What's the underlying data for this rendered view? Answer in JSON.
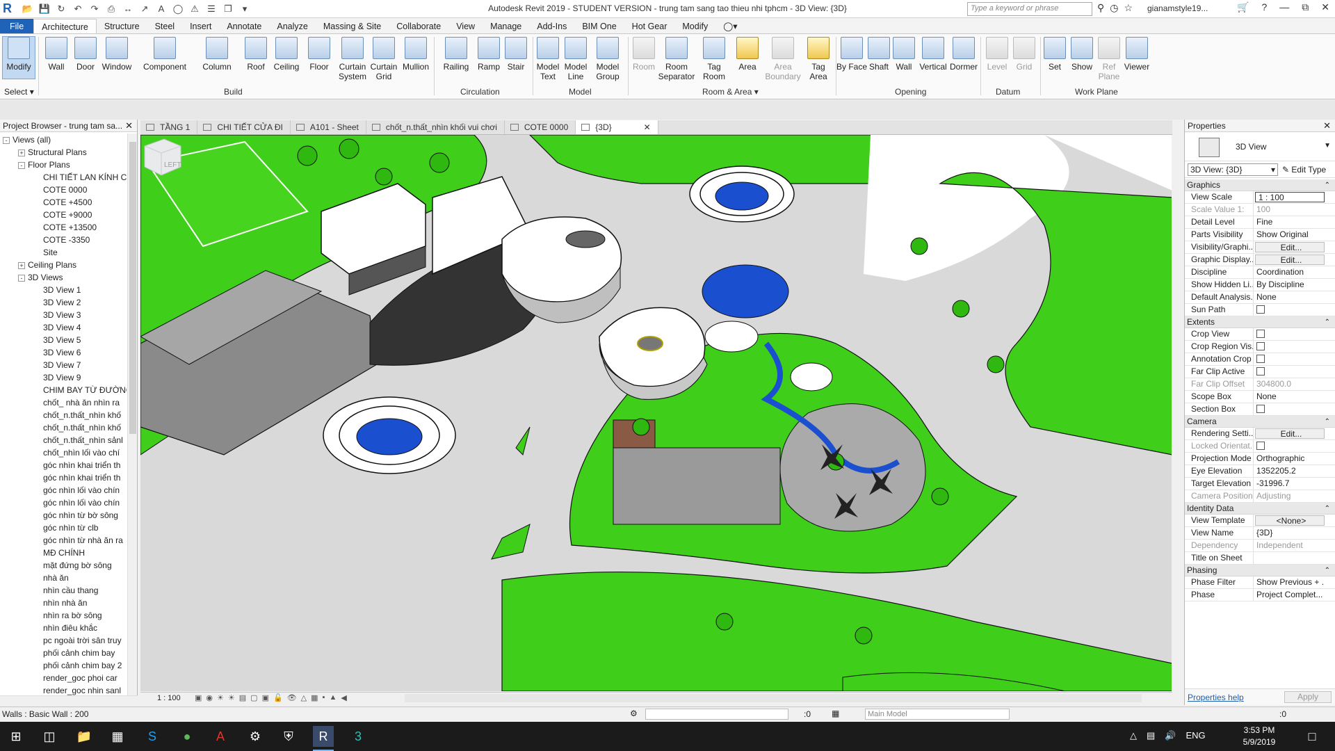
{
  "app": {
    "title": "Autodesk Revit 2019 - STUDENT VERSION - trung tam sang tao thieu nhi tphcm - 3D View: {3D}",
    "logo": "R",
    "search_placeholder": "Type a keyword or phrase",
    "user": "gianamstyle19...",
    "accent": "#1f63b8"
  },
  "ribbon_tabs": [
    "File",
    "Architecture",
    "Structure",
    "Steel",
    "Insert",
    "Annotate",
    "Analyze",
    "Massing & Site",
    "Collaborate",
    "View",
    "Manage",
    "Add-Ins",
    "BIM One",
    "Hot Gear",
    "Modify"
  ],
  "ribbon": {
    "select_label": "Select",
    "modify": "Modify",
    "build": [
      "Wall",
      "Door",
      "Window",
      "Component",
      "Column",
      "Roof",
      "Ceiling",
      "Floor",
      "Curtain System",
      "Curtain Grid",
      "Mullion"
    ],
    "circulation": [
      "Railing",
      "Ramp",
      "Stair"
    ],
    "model": [
      "Model Text",
      "Model Line",
      "Model Group"
    ],
    "room_area": [
      "Room",
      "Room Separator",
      "Tag Room",
      "Area",
      "Area Boundary",
      "Tag Area"
    ],
    "opening": [
      "By Face",
      "Shaft",
      "Wall",
      "Vertical",
      "Dormer"
    ],
    "datum": [
      "Level",
      "Grid"
    ],
    "work_plane": [
      "Set",
      "Show",
      "Ref Plane",
      "Viewer"
    ],
    "panels": {
      "build": "Build",
      "circulation": "Circulation",
      "model": "Model",
      "room_area": "Room & Area",
      "opening": "Opening",
      "datum": "Datum",
      "work_plane": "Work Plane"
    }
  },
  "project_browser": {
    "title": "Project Browser - trung tam sa...",
    "rows": [
      {
        "t": "Views (all)",
        "lvl": 0,
        "tg": "-"
      },
      {
        "t": "Structural Plans",
        "lvl": 1,
        "tg": "+"
      },
      {
        "t": "Floor Plans",
        "lvl": 1,
        "tg": "-"
      },
      {
        "t": "CHI TIẾT LAN KÍNH CẦU",
        "lvl": 2
      },
      {
        "t": "COTE 0000",
        "lvl": 2
      },
      {
        "t": "COTE +4500",
        "lvl": 2
      },
      {
        "t": "COTE +9000",
        "lvl": 2
      },
      {
        "t": "COTE +13500",
        "lvl": 2
      },
      {
        "t": "COTE -3350",
        "lvl": 2
      },
      {
        "t": "Site",
        "lvl": 2
      },
      {
        "t": "Ceiling Plans",
        "lvl": 1,
        "tg": "+"
      },
      {
        "t": "3D Views",
        "lvl": 1,
        "tg": "-"
      },
      {
        "t": "3D View 1",
        "lvl": 2
      },
      {
        "t": "3D View 2",
        "lvl": 2
      },
      {
        "t": "3D View 3",
        "lvl": 2
      },
      {
        "t": "3D View 4",
        "lvl": 2
      },
      {
        "t": "3D View 5",
        "lvl": 2
      },
      {
        "t": "3D View 6",
        "lvl": 2
      },
      {
        "t": "3D View 7",
        "lvl": 2
      },
      {
        "t": "3D View 9",
        "lvl": 2
      },
      {
        "t": "CHIM BAY TỪ ĐƯỜNG",
        "lvl": 2
      },
      {
        "t": "chốt_ nhà ăn nhìn ra",
        "lvl": 2
      },
      {
        "t": "chốt_n.thất_nhìn khố",
        "lvl": 2
      },
      {
        "t": "chốt_n.thất_nhìn khố",
        "lvl": 2
      },
      {
        "t": "chốt_n.thất_nhìn sảnl",
        "lvl": 2
      },
      {
        "t": "chốt_nhìn lối vào chí",
        "lvl": 2
      },
      {
        "t": "góc nhìn khai triển th",
        "lvl": 2
      },
      {
        "t": "góc nhìn khai triển th",
        "lvl": 2
      },
      {
        "t": "góc nhìn lối vào chín",
        "lvl": 2
      },
      {
        "t": "góc nhìn lối vào chín",
        "lvl": 2
      },
      {
        "t": "góc nhìn từ bờ sông",
        "lvl": 2
      },
      {
        "t": "góc nhìn từ clb",
        "lvl": 2
      },
      {
        "t": "góc nhìn từ nhà ăn ra",
        "lvl": 2
      },
      {
        "t": "MĐ CHÍNH",
        "lvl": 2
      },
      {
        "t": "mặt đứng bờ sông",
        "lvl": 2
      },
      {
        "t": "nhà ăn",
        "lvl": 2
      },
      {
        "t": "nhìn cầu thang",
        "lvl": 2
      },
      {
        "t": "nhìn nhà ăn",
        "lvl": 2
      },
      {
        "t": "nhìn ra bờ sông",
        "lvl": 2
      },
      {
        "t": "nhìn điêu khắc",
        "lvl": 2
      },
      {
        "t": "pc ngoài trời sân truy",
        "lvl": 2
      },
      {
        "t": "phối cảnh chim bay",
        "lvl": 2
      },
      {
        "t": "phối cảnh chim bay 2",
        "lvl": 2
      },
      {
        "t": "render_goc  phoi car",
        "lvl": 2
      },
      {
        "t": "render_goc nhin sanl",
        "lvl": 2
      }
    ]
  },
  "view_tabs": [
    "TẦNG 1",
    "CHI TIẾT CỬA ĐI",
    "A101 - Sheet",
    "chốt_n.thất_nhìn khối vui chơi",
    "COTE 0000",
    "{3D}"
  ],
  "viewcube_label": "LEFT",
  "view_control": {
    "scale": "1 : 100"
  },
  "properties": {
    "title": "Properties",
    "type_name": "3D View",
    "selector": "3D View: {3D}",
    "edit_type": "Edit Type",
    "help": "Properties help",
    "apply": "Apply",
    "sections": [
      {
        "name": "Graphics",
        "rows": [
          {
            "k": "View Scale",
            "v": "1 : 100",
            "style": "boxed"
          },
          {
            "k": "Scale Value    1:",
            "v": "100",
            "dim": true
          },
          {
            "k": "Detail Level",
            "v": "Fine"
          },
          {
            "k": "Parts Visibility",
            "v": "Show Original"
          },
          {
            "k": "Visibility/Graphi...",
            "v": "Edit...",
            "style": "btn"
          },
          {
            "k": "Graphic Display...",
            "v": "Edit...",
            "style": "btn"
          },
          {
            "k": "Discipline",
            "v": "Coordination"
          },
          {
            "k": "Show Hidden Li...",
            "v": "By Discipline"
          },
          {
            "k": "Default Analysis...",
            "v": "None"
          },
          {
            "k": "Sun Path",
            "v": "",
            "cb": true
          }
        ]
      },
      {
        "name": "Extents",
        "rows": [
          {
            "k": "Crop View",
            "v": "",
            "cb": true
          },
          {
            "k": "Crop Region Vis...",
            "v": "",
            "cb": true
          },
          {
            "k": "Annotation Crop",
            "v": "",
            "cb": true
          },
          {
            "k": "Far Clip Active",
            "v": "",
            "cb": true
          },
          {
            "k": "Far Clip Offset",
            "v": "304800.0",
            "dim": true
          },
          {
            "k": "Scope Box",
            "v": "None"
          },
          {
            "k": "Section Box",
            "v": "",
            "cb": true
          }
        ]
      },
      {
        "name": "Camera",
        "rows": [
          {
            "k": "Rendering Setti...",
            "v": "Edit...",
            "style": "btn"
          },
          {
            "k": "Locked Orientat...",
            "v": "",
            "dim": true,
            "cb": true
          },
          {
            "k": "Projection Mode",
            "v": "Orthographic"
          },
          {
            "k": "Eye Elevation",
            "v": "1352205.2"
          },
          {
            "k": "Target Elevation",
            "v": "-31996.7"
          },
          {
            "k": "Camera Position",
            "v": "Adjusting",
            "dim": true
          }
        ]
      },
      {
        "name": "Identity Data",
        "rows": [
          {
            "k": "View Template",
            "v": "<None>",
            "style": "btn"
          },
          {
            "k": "View Name",
            "v": "{3D}"
          },
          {
            "k": "Dependency",
            "v": "Independent",
            "dim": true
          },
          {
            "k": "Title on Sheet",
            "v": ""
          }
        ]
      },
      {
        "name": "Phasing",
        "rows": [
          {
            "k": "Phase Filter",
            "v": "Show Previous + ..."
          },
          {
            "k": "Phase",
            "v": "Project Complet..."
          }
        ]
      }
    ]
  },
  "status": {
    "message": "Walls : Basic Wall : 200",
    "zero": ":0",
    "main_model": "Main Model",
    "right_zero": ":0"
  },
  "taskbar": {
    "time": "3:53 PM",
    "date": "5/9/2019",
    "lang": "ENG"
  },
  "colors": {
    "grass": "#3fcf1a",
    "paving": "#d9d9d9",
    "water": "#1a4fd0",
    "roof": "#ffffff",
    "dark_roof": "#555555",
    "taskbar": "#1b1b1b"
  }
}
